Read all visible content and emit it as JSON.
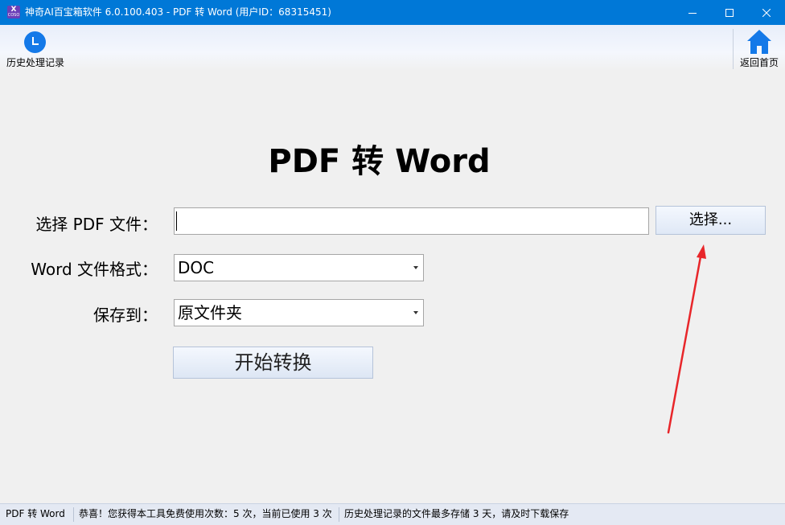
{
  "window": {
    "title": "神奇AI百宝箱软件 6.0.100.403 - PDF 转 Word (用户ID：68315451)",
    "icon_text": "X",
    "icon_subtext": "COSO"
  },
  "toolbar": {
    "history_label": "历史处理记录",
    "home_label": "返回首页"
  },
  "main": {
    "title": "PDF 转 Word",
    "file_label": "选择 PDF 文件：",
    "file_value": "",
    "choose_button": "选择...",
    "format_label": "Word 文件格式：",
    "format_value": "DOC",
    "save_label": "保存到：",
    "save_value": "原文件夹",
    "start_button": "开始转换"
  },
  "status": {
    "tool_name": "PDF 转 Word",
    "usage_text": "恭喜！您获得本工具免费使用次数：5 次，当前已使用 3 次",
    "storage_text": "历史处理记录的文件最多存储 3 天，请及时下载保存"
  },
  "colors": {
    "titlebar": "#0078d7",
    "accent_icon": "#1479e8",
    "annotation_arrow": "#e8262a"
  }
}
